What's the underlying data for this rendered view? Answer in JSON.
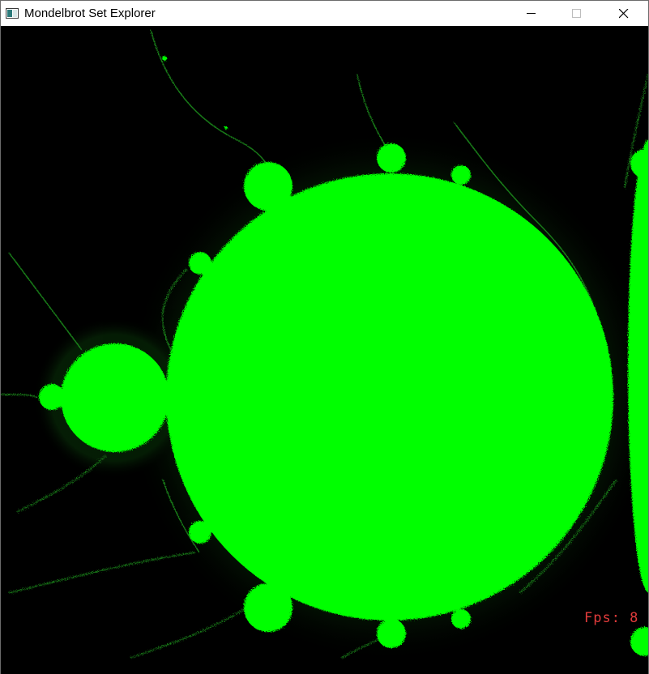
{
  "window": {
    "title": "Mondelbrot Set Explorer",
    "controls": {
      "minimize": "minimize-icon",
      "maximize": "maximize-icon",
      "close": "close-icon"
    }
  },
  "overlay": {
    "fps_text": "Fps: 8"
  },
  "colors": {
    "set_fill": "#00ff00",
    "background": "#000000",
    "fps_text": "#e23b3b"
  }
}
